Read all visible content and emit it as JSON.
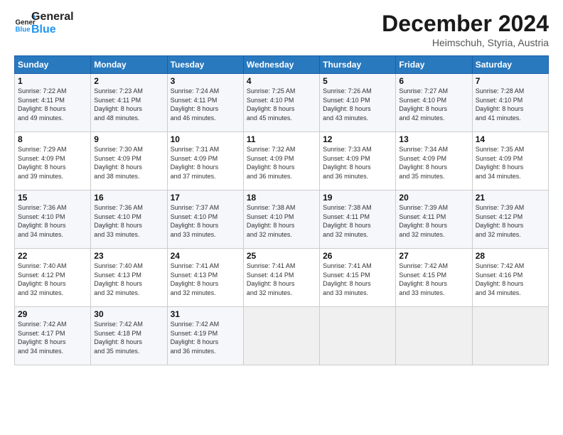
{
  "logo": {
    "line1": "General",
    "line2": "Blue"
  },
  "header": {
    "month": "December 2024",
    "location": "Heimschuh, Styria, Austria"
  },
  "weekdays": [
    "Sunday",
    "Monday",
    "Tuesday",
    "Wednesday",
    "Thursday",
    "Friday",
    "Saturday"
  ],
  "weeks": [
    [
      {
        "day": "1",
        "sunrise": "7:22 AM",
        "sunset": "4:11 PM",
        "daylight": "8 hours and 49 minutes."
      },
      {
        "day": "2",
        "sunrise": "7:23 AM",
        "sunset": "4:11 PM",
        "daylight": "8 hours and 48 minutes."
      },
      {
        "day": "3",
        "sunrise": "7:24 AM",
        "sunset": "4:11 PM",
        "daylight": "8 hours and 46 minutes."
      },
      {
        "day": "4",
        "sunrise": "7:25 AM",
        "sunset": "4:10 PM",
        "daylight": "8 hours and 45 minutes."
      },
      {
        "day": "5",
        "sunrise": "7:26 AM",
        "sunset": "4:10 PM",
        "daylight": "8 hours and 43 minutes."
      },
      {
        "day": "6",
        "sunrise": "7:27 AM",
        "sunset": "4:10 PM",
        "daylight": "8 hours and 42 minutes."
      },
      {
        "day": "7",
        "sunrise": "7:28 AM",
        "sunset": "4:10 PM",
        "daylight": "8 hours and 41 minutes."
      }
    ],
    [
      {
        "day": "8",
        "sunrise": "7:29 AM",
        "sunset": "4:09 PM",
        "daylight": "8 hours and 39 minutes."
      },
      {
        "day": "9",
        "sunrise": "7:30 AM",
        "sunset": "4:09 PM",
        "daylight": "8 hours and 38 minutes."
      },
      {
        "day": "10",
        "sunrise": "7:31 AM",
        "sunset": "4:09 PM",
        "daylight": "8 hours and 37 minutes."
      },
      {
        "day": "11",
        "sunrise": "7:32 AM",
        "sunset": "4:09 PM",
        "daylight": "8 hours and 36 minutes."
      },
      {
        "day": "12",
        "sunrise": "7:33 AM",
        "sunset": "4:09 PM",
        "daylight": "8 hours and 36 minutes."
      },
      {
        "day": "13",
        "sunrise": "7:34 AM",
        "sunset": "4:09 PM",
        "daylight": "8 hours and 35 minutes."
      },
      {
        "day": "14",
        "sunrise": "7:35 AM",
        "sunset": "4:09 PM",
        "daylight": "8 hours and 34 minutes."
      }
    ],
    [
      {
        "day": "15",
        "sunrise": "7:36 AM",
        "sunset": "4:10 PM",
        "daylight": "8 hours and 34 minutes."
      },
      {
        "day": "16",
        "sunrise": "7:36 AM",
        "sunset": "4:10 PM",
        "daylight": "8 hours and 33 minutes."
      },
      {
        "day": "17",
        "sunrise": "7:37 AM",
        "sunset": "4:10 PM",
        "daylight": "8 hours and 33 minutes."
      },
      {
        "day": "18",
        "sunrise": "7:38 AM",
        "sunset": "4:10 PM",
        "daylight": "8 hours and 32 minutes."
      },
      {
        "day": "19",
        "sunrise": "7:38 AM",
        "sunset": "4:11 PM",
        "daylight": "8 hours and 32 minutes."
      },
      {
        "day": "20",
        "sunrise": "7:39 AM",
        "sunset": "4:11 PM",
        "daylight": "8 hours and 32 minutes."
      },
      {
        "day": "21",
        "sunrise": "7:39 AM",
        "sunset": "4:12 PM",
        "daylight": "8 hours and 32 minutes."
      }
    ],
    [
      {
        "day": "22",
        "sunrise": "7:40 AM",
        "sunset": "4:12 PM",
        "daylight": "8 hours and 32 minutes."
      },
      {
        "day": "23",
        "sunrise": "7:40 AM",
        "sunset": "4:13 PM",
        "daylight": "8 hours and 32 minutes."
      },
      {
        "day": "24",
        "sunrise": "7:41 AM",
        "sunset": "4:13 PM",
        "daylight": "8 hours and 32 minutes."
      },
      {
        "day": "25",
        "sunrise": "7:41 AM",
        "sunset": "4:14 PM",
        "daylight": "8 hours and 32 minutes."
      },
      {
        "day": "26",
        "sunrise": "7:41 AM",
        "sunset": "4:15 PM",
        "daylight": "8 hours and 33 minutes."
      },
      {
        "day": "27",
        "sunrise": "7:42 AM",
        "sunset": "4:15 PM",
        "daylight": "8 hours and 33 minutes."
      },
      {
        "day": "28",
        "sunrise": "7:42 AM",
        "sunset": "4:16 PM",
        "daylight": "8 hours and 34 minutes."
      }
    ],
    [
      {
        "day": "29",
        "sunrise": "7:42 AM",
        "sunset": "4:17 PM",
        "daylight": "8 hours and 34 minutes."
      },
      {
        "day": "30",
        "sunrise": "7:42 AM",
        "sunset": "4:18 PM",
        "daylight": "8 hours and 35 minutes."
      },
      {
        "day": "31",
        "sunrise": "7:42 AM",
        "sunset": "4:19 PM",
        "daylight": "8 hours and 36 minutes."
      },
      null,
      null,
      null,
      null
    ]
  ]
}
